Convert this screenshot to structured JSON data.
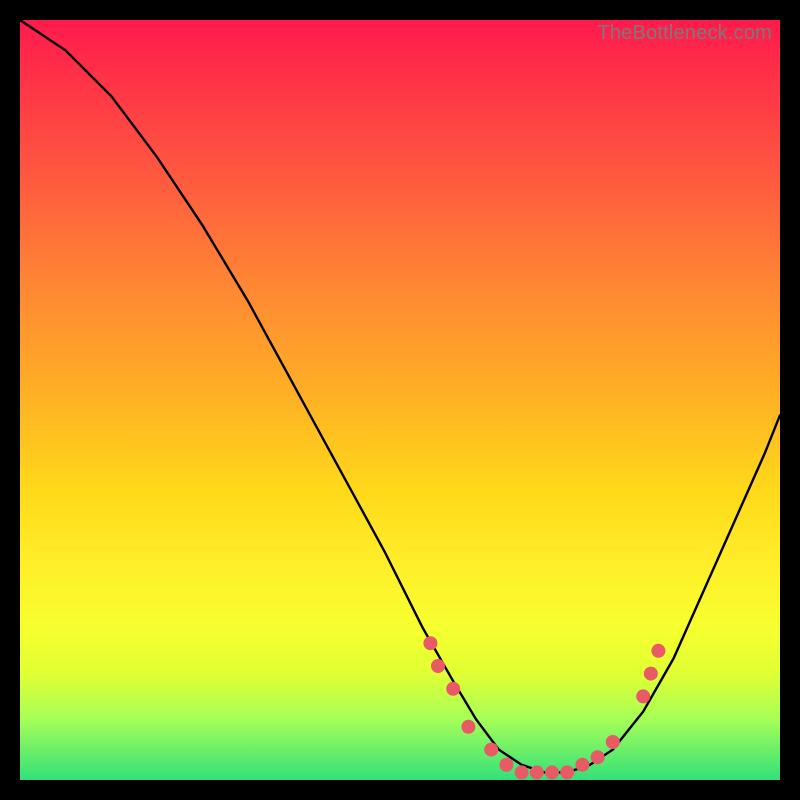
{
  "watermark": "TheBottleneck.com",
  "chart_data": {
    "type": "line",
    "title": "",
    "xlabel": "",
    "ylabel": "",
    "xlim": [
      0,
      100
    ],
    "ylim": [
      0,
      100
    ],
    "grid": false,
    "legend": false,
    "series": [
      {
        "name": "bottleneck-curve",
        "x": [
          0,
          6,
          12,
          18,
          24,
          30,
          36,
          42,
          48,
          53,
          57,
          60,
          63,
          66,
          69,
          72,
          75,
          78,
          82,
          86,
          90,
          94,
          98,
          100
        ],
        "y": [
          100,
          96,
          90,
          82,
          73,
          63,
          52,
          41,
          30,
          20,
          13,
          8,
          4,
          2,
          1,
          1,
          2,
          4,
          9,
          16,
          25,
          34,
          43,
          48
        ]
      }
    ],
    "markers": {
      "name": "highlight-dots",
      "color": "#e85b64",
      "radius_px": 7,
      "points": [
        {
          "x": 54,
          "y": 18
        },
        {
          "x": 55,
          "y": 15
        },
        {
          "x": 57,
          "y": 12
        },
        {
          "x": 59,
          "y": 7
        },
        {
          "x": 62,
          "y": 4
        },
        {
          "x": 64,
          "y": 2
        },
        {
          "x": 66,
          "y": 1
        },
        {
          "x": 68,
          "y": 1
        },
        {
          "x": 70,
          "y": 1
        },
        {
          "x": 72,
          "y": 1
        },
        {
          "x": 74,
          "y": 2
        },
        {
          "x": 76,
          "y": 3
        },
        {
          "x": 78,
          "y": 5
        },
        {
          "x": 82,
          "y": 11
        },
        {
          "x": 83,
          "y": 14
        },
        {
          "x": 84,
          "y": 17
        }
      ]
    },
    "background_gradient": {
      "top": "#ff1a4d",
      "bottom": "#33e07a"
    }
  }
}
